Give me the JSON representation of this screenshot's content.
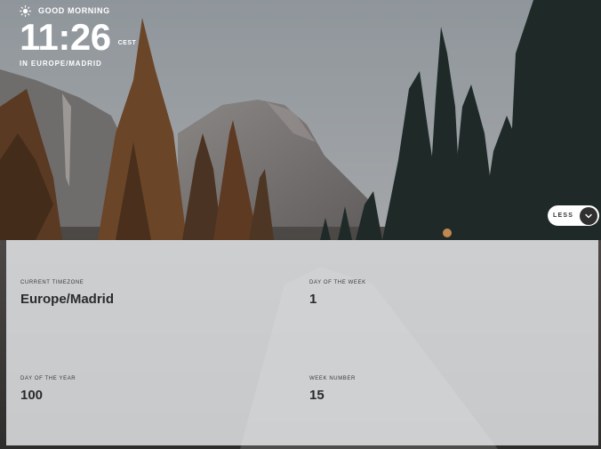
{
  "header": {
    "greeting": "GOOD MORNING",
    "greeting_icon": "sun-icon",
    "time": "11:26",
    "timezone_abbr": "CEST",
    "location": "IN EUROPE/MADRID"
  },
  "toggle": {
    "label": "LESS",
    "icon": "chevron-down-icon"
  },
  "details": {
    "timezone_label": "CURRENT TIMEZONE",
    "timezone_value": "Europe/Madrid",
    "day_of_week_label": "DAY OF THE WEEK",
    "day_of_week_value": "1",
    "day_of_year_label": "DAY OF THE YEAR",
    "day_of_year_value": "100",
    "week_number_label": "WEEK NUMBER",
    "week_number_value": "15"
  },
  "colors": {
    "text": "#ffffff",
    "panel_bg": "#eef0f2",
    "panel_text": "#2b2b2b",
    "button_bg": "#ffffff",
    "chevron_bg": "#303030"
  }
}
